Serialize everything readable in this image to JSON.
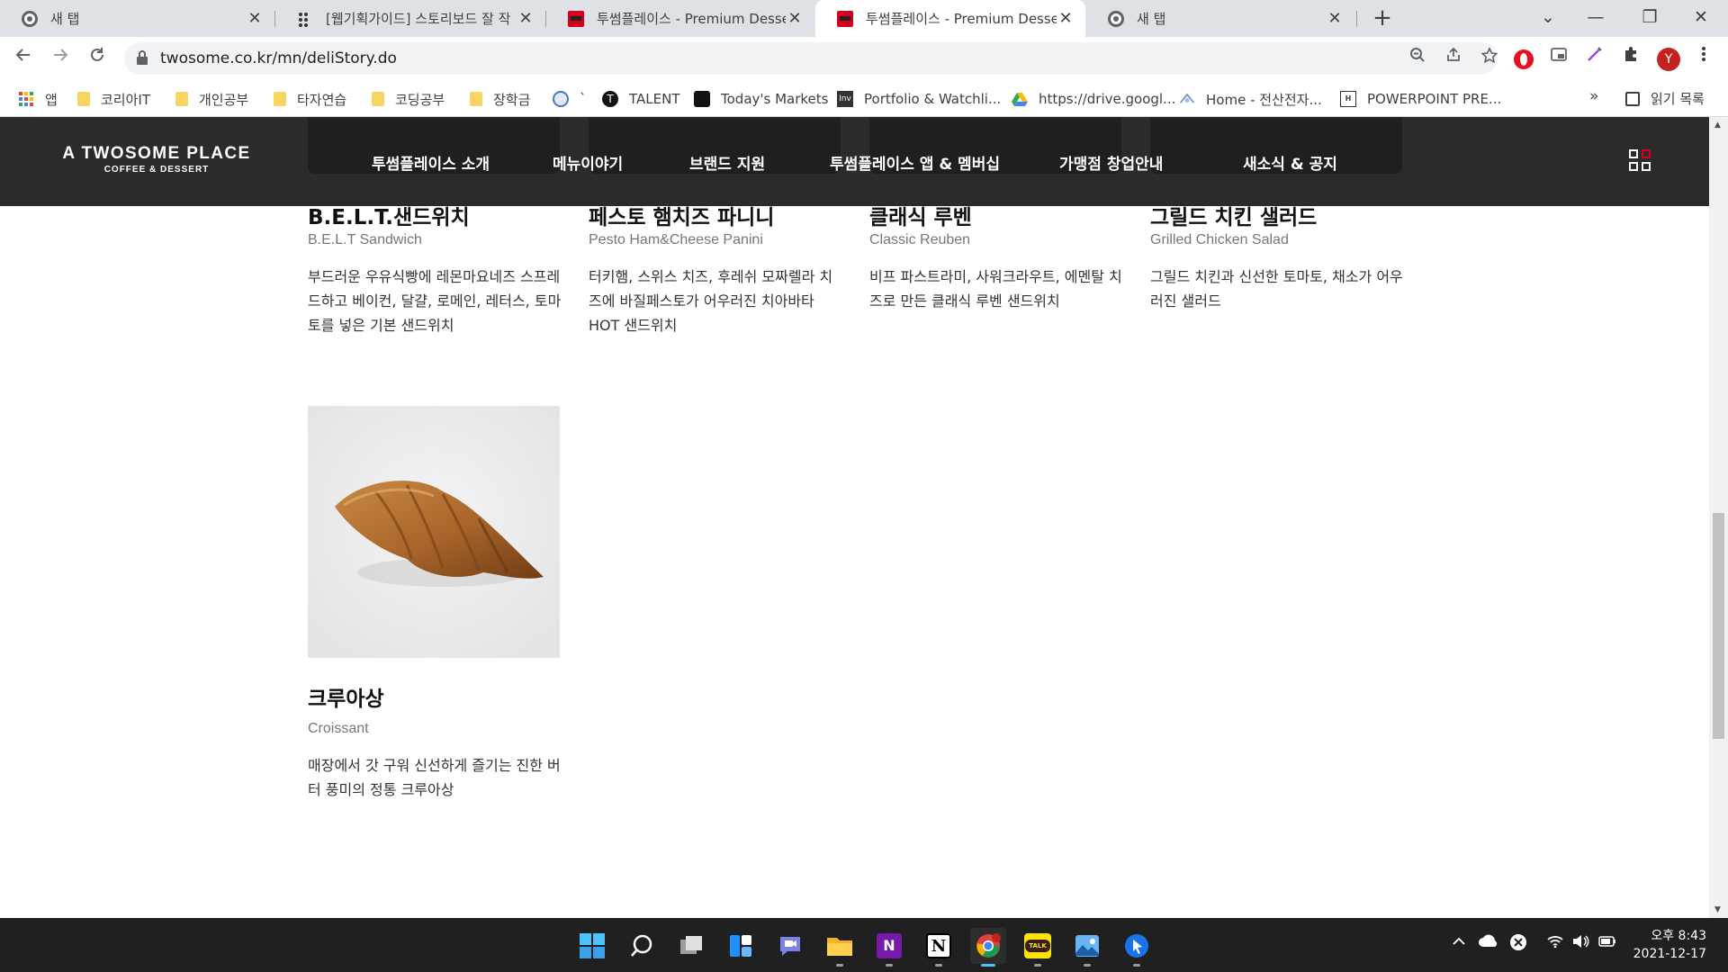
{
  "browser": {
    "tabs": [
      {
        "title": "새 탭",
        "icon": "chrome-icon",
        "active": false
      },
      {
        "title": "[웹기획가이드] 스토리보드 잘 작",
        "icon": "dots-icon",
        "active": false
      },
      {
        "title": "투썸플레이스 - Premium Dessert",
        "icon": "twosome-favicon",
        "active": false
      },
      {
        "title": "투썸플레이스 - Premium Dessert",
        "icon": "twosome-favicon",
        "active": true
      },
      {
        "title": "새 탭",
        "icon": "chrome-icon",
        "active": false
      }
    ],
    "close_glyph": "✕",
    "new_tab_glyph": "+",
    "window_controls": {
      "dropdown": "⌄",
      "minimize": "—",
      "restore": "❐",
      "close": "✕"
    },
    "url": "twosome.co.kr/mn/deliStory.do",
    "avatar_letter": "Y",
    "bookmarks": [
      {
        "label": "앱",
        "icon": "apps-grid-icon"
      },
      {
        "label": "코리아IT",
        "icon": "folder-icon"
      },
      {
        "label": "개인공부",
        "icon": "folder-icon"
      },
      {
        "label": "타자연습",
        "icon": "folder-icon"
      },
      {
        "label": "코딩공부",
        "icon": "folder-icon"
      },
      {
        "label": "장학금",
        "icon": "folder-icon"
      },
      {
        "label": "`",
        "icon": "globe-icon"
      },
      {
        "label": "TALENT",
        "icon": "talent-icon"
      },
      {
        "label": "Today's Markets",
        "icon": "markets-icon"
      },
      {
        "label": "Portfolio & Watchli...",
        "icon": "investing-icon"
      },
      {
        "label": "https://drive.googl...",
        "icon": "google-drive-icon"
      },
      {
        "label": "Home - 전산전자...",
        "icon": "home-icon"
      },
      {
        "label": "POWERPOINT PRE...",
        "icon": "powerpoint-icon"
      }
    ],
    "bookmarks_more": "»",
    "reading_list": "읽기 목록"
  },
  "site": {
    "logo_main": "A TWOSOME PLACE",
    "logo_sub": "COFFEE & DESSERT",
    "nav": [
      "투썸플레이스 소개",
      "메뉴이야기",
      "브랜드 지원",
      "투썸플레이스 앱 & 멤버십",
      "가맹점 창업안내",
      "새소식 & 공지"
    ]
  },
  "menu_items": [
    {
      "ko": "B.E.L.T.샌드위치",
      "en": "B.E.L.T Sandwich",
      "desc": "부드러운 우유식빵에 레몬마요네즈 스프레드하고 베이컨, 달걀, 로메인, 레터스, 토마토를 넣은 기본 샌드위치"
    },
    {
      "ko": "페스토 햄치즈 파니니",
      "en": "Pesto Ham&Cheese Panini",
      "desc": "터키햄, 스위스 치즈, 후레쉬 모짜렐라 치즈에 바질페스토가 어우러진 치아바타 HOT 샌드위치"
    },
    {
      "ko": "클래식 루벤",
      "en": "Classic Reuben",
      "desc": "비프 파스트라미, 사워크라우트, 에멘탈 치즈로 만든 클래식 루벤 샌드위치"
    },
    {
      "ko": "그릴드 치킨 샐러드",
      "en": "Grilled Chicken Salad",
      "desc": "그릴드 치킨과 신선한 토마토, 채소가 어우러진 샐러드"
    },
    {
      "ko": "크루아상",
      "en": "Croissant",
      "desc": "매장에서 갓 구워 신선하게 즐기는 진한 버터 풍미의 정통 크루아상"
    }
  ],
  "taskbar": {
    "apps": [
      "start-icon",
      "search-icon",
      "task-view-icon",
      "widgets-icon",
      "teams-chat-icon",
      "file-explorer-icon",
      "onenote-icon",
      "notion-icon",
      "chrome-icon",
      "kakaotalk-icon",
      "photos-icon",
      "app-icon"
    ],
    "onenote_letter": "N",
    "notion_letter": "N",
    "kakao_label": "TALK",
    "time": "오후 8:43",
    "date": "2021-12-17"
  },
  "colors": {
    "header_bg": "#2b2b2b",
    "accent_red": "#d6001c",
    "taskbar_bg": "#202020"
  }
}
